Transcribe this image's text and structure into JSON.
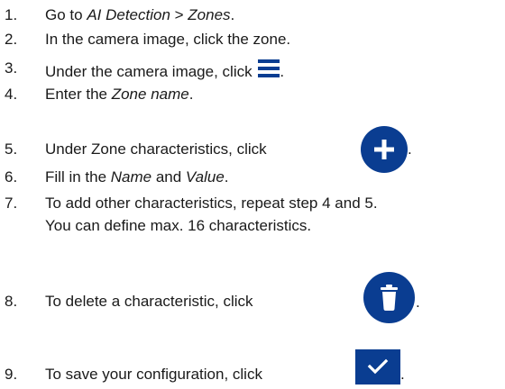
{
  "steps": [
    {
      "num": "1.",
      "a": "Go to ",
      "b": "AI Detection",
      "c": " > ",
      "d": "Zones",
      "e": "."
    },
    {
      "num": "2.",
      "text": "In the camera image, click the zone."
    },
    {
      "num": "3.",
      "text": "Under the camera image, click",
      "end": "."
    },
    {
      "num": "4.",
      "a": "Enter the ",
      "b": "Zone name",
      "c": "."
    },
    {
      "num": "5.",
      "text": "Under Zone characteristics, click",
      "end": "."
    },
    {
      "num": "6.",
      "a": "Fill in the ",
      "b": "Name",
      "c": " and ",
      "d": "Value",
      "e": "."
    },
    {
      "num": "7.",
      "text": "To add other characteristics, repeat step 4 and 5.",
      "sub": "You can define max. 16 characteristics."
    },
    {
      "num": "8.",
      "text": "To delete a characteristic, click",
      "end": "."
    },
    {
      "num": "9.",
      "text": "To save your configuration, click",
      "end": "."
    }
  ],
  "icons": {
    "list": "list-menu-icon",
    "add": "plus-circle-icon",
    "delete": "trash-circle-icon",
    "save": "checkmark-icon"
  },
  "colors": {
    "accent": "#0a3d91",
    "list_icon": "#0a3d91"
  }
}
